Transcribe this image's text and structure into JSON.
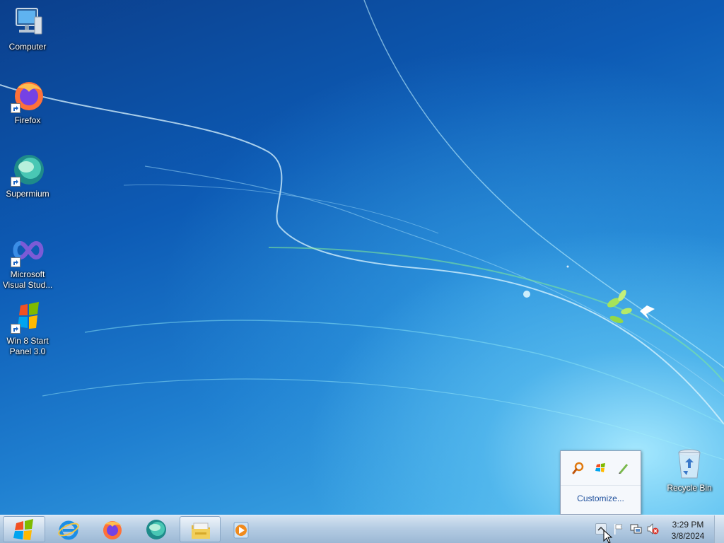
{
  "desktop": {
    "icons": [
      {
        "name": "computer-icon",
        "label": "Computer",
        "shortcut": false
      },
      {
        "name": "firefox-icon",
        "label": "Firefox",
        "shortcut": true
      },
      {
        "name": "supermium-icon",
        "label": "Supermium",
        "shortcut": true
      },
      {
        "name": "visual-studio-icon",
        "label": "Microsoft Visual Stud...",
        "shortcut": true
      },
      {
        "name": "win8-start-panel-icon",
        "label": "Win 8 Start Panel 3.0",
        "shortcut": true
      }
    ],
    "recycle_bin": {
      "label": "Recycle Bin",
      "icon": "recycle-bin-icon"
    }
  },
  "tray_popup": {
    "icons": [
      "search-magnifier-icon",
      "windows-flag-icon",
      "pen-icon"
    ],
    "customize_label": "Customize..."
  },
  "taskbar": {
    "start_icon": "windows-orb-icon",
    "pinned": [
      {
        "name": "internet-explorer-icon",
        "active": false
      },
      {
        "name": "firefox-icon",
        "active": false
      },
      {
        "name": "supermium-icon",
        "active": false
      },
      {
        "name": "file-explorer-icon",
        "active": true
      },
      {
        "name": "media-player-icon",
        "active": false
      }
    ],
    "tray_icons": [
      "show-hidden-icons-arrow",
      "action-center-flag-icon",
      "network-icon",
      "volume-muted-icon"
    ],
    "clock": {
      "time": "3:29 PM",
      "date": "3/8/2024"
    }
  },
  "colors": {
    "wallpaper_top": "#0b3f8c",
    "wallpaper_bottom": "#5ec3f0",
    "link": "#1e4f9c"
  }
}
